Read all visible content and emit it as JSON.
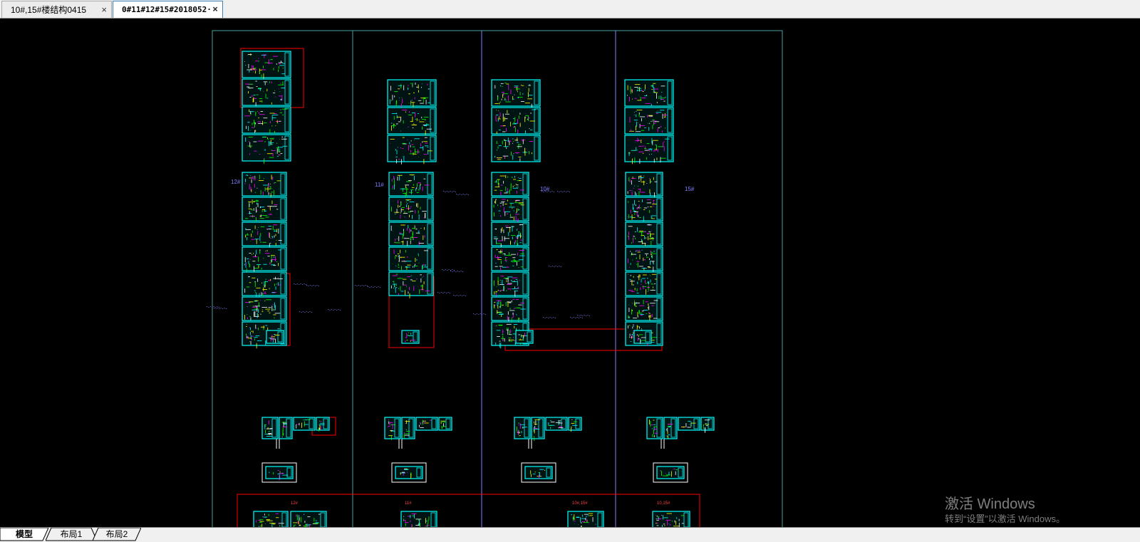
{
  "tabs": [
    {
      "label": "10#,15#楼结构0415",
      "active": false
    },
    {
      "label": "0#11#12#15#2018052·",
      "active": true
    }
  ],
  "tab_close_glyph": "×",
  "canvas": {
    "building_labels": [
      "12#",
      "11#",
      "10#",
      "15#"
    ],
    "bottom_labels": [
      "12#",
      "11#",
      "10#,15#",
      "10,15#"
    ]
  },
  "watermark": {
    "line1": "激活 Windows",
    "line2": "转到“设置”以激活 Windows。"
  },
  "layout_tabs": [
    {
      "label": "模型",
      "active": true
    },
    {
      "label": "布局1",
      "active": false
    },
    {
      "label": "布局2",
      "active": false
    }
  ],
  "colors": {
    "background": "#000000",
    "cyan": "#00ffff",
    "red": "#ff0000",
    "purple": "#8080ff",
    "green": "#00ff00",
    "magenta": "#ff00ff"
  }
}
